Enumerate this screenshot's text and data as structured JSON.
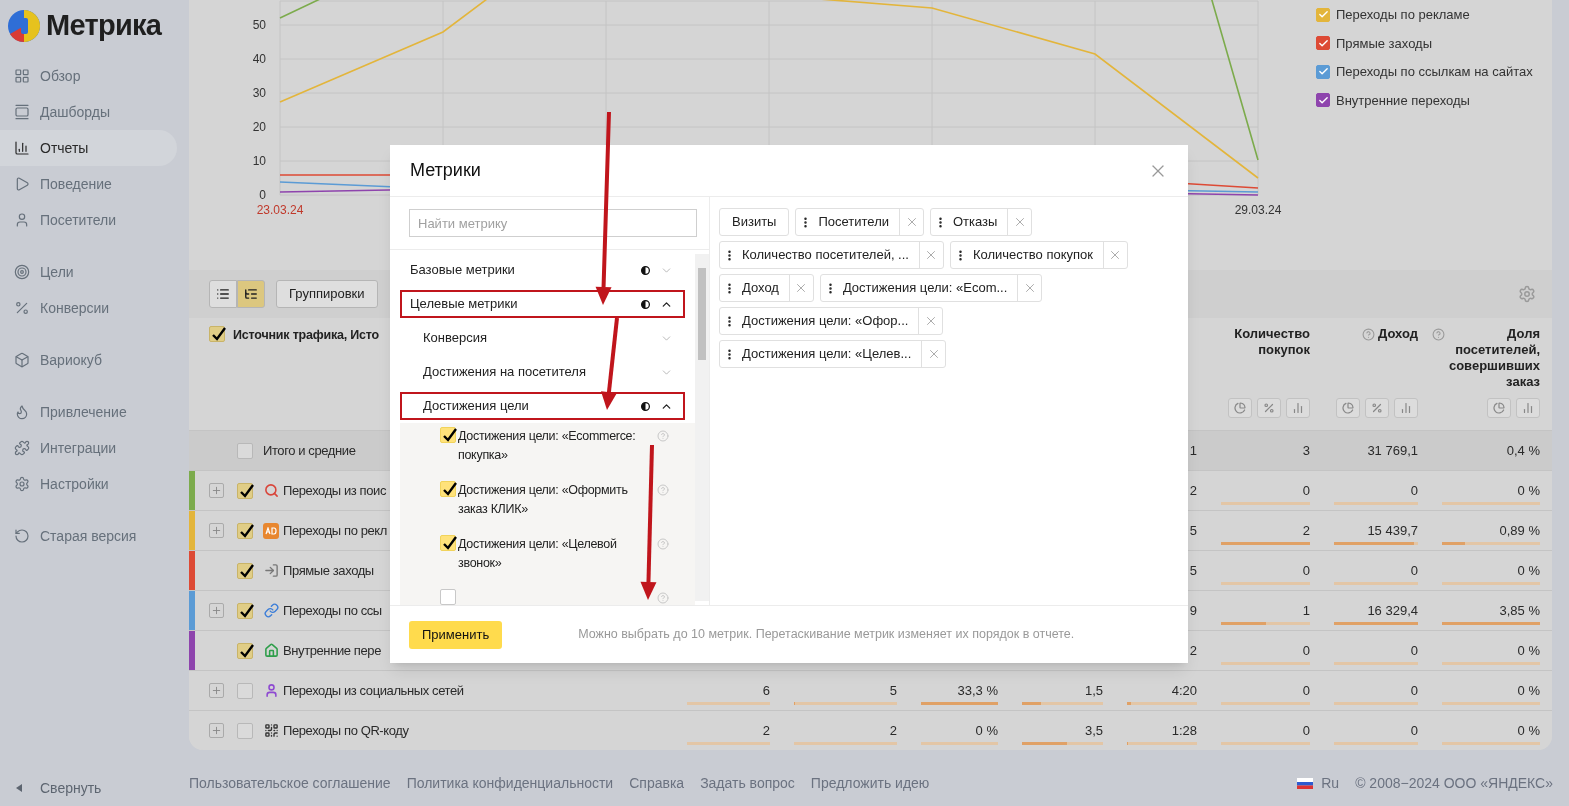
{
  "logo": {
    "text": "Метрика"
  },
  "sidebar": {
    "groups": [
      [
        {
          "label": "Обзор",
          "selected": false
        },
        {
          "label": "Дашборды",
          "selected": false
        },
        {
          "label": "Отчеты",
          "selected": true
        },
        {
          "label": "Поведение",
          "selected": false
        },
        {
          "label": "Посетители",
          "selected": false
        }
      ],
      [
        {
          "label": "Цели",
          "selected": false
        },
        {
          "label": "Конверсии",
          "selected": false
        }
      ],
      [
        {
          "label": "Вариокуб",
          "selected": false
        }
      ],
      [
        {
          "label": "Привлечение",
          "selected": false
        },
        {
          "label": "Интеграции",
          "selected": false
        },
        {
          "label": "Настройки",
          "selected": false
        }
      ],
      [
        {
          "label": "Старая версия",
          "selected": false
        }
      ]
    ],
    "collapse": "Свернуть"
  },
  "chart": {
    "y_labels": [
      "50",
      "40",
      "30",
      "20",
      "10",
      "0"
    ],
    "date_labels": [
      {
        "label": "23.03.24",
        "weekend": true
      },
      {
        "label": "29.03.24",
        "weekend": false
      }
    ],
    "legend": [
      {
        "label": "Переходы по рекламе",
        "checked": true,
        "color": "#e3b53b"
      },
      {
        "label": "Прямые заходы",
        "checked": true,
        "color": "#dd4a35"
      },
      {
        "label": "Переходы по ссылкам на сайтах",
        "checked": true,
        "color": "#5b9bd5"
      },
      {
        "label": "Внутренние переходы",
        "checked": true,
        "color": "#8e44ad"
      }
    ]
  },
  "toolbar": {
    "views": [
      {
        "kind": "list",
        "selected": false
      },
      {
        "kind": "tree",
        "selected": true
      }
    ],
    "grouping": "Группировки"
  },
  "table": {
    "dimension": {
      "label": "Источник трафика, Исто",
      "checked": true
    },
    "columns": [
      {},
      {},
      {},
      {},
      {},
      {
        "label": "Количество покупок",
        "help": false,
        "tools": [
          {
            "kind": "pie"
          },
          {
            "kind": "percent"
          },
          {
            "kind": "bars"
          }
        ]
      },
      {
        "label": "Доход",
        "help": true,
        "tools": [
          {
            "kind": "pie"
          },
          {
            "kind": "percent"
          },
          {
            "kind": "bars"
          }
        ]
      },
      {
        "label": "Доля посетителей, совершивших заказ",
        "help": true,
        "tools": [
          {
            "kind": "pie"
          },
          {
            "kind": "bars"
          }
        ]
      }
    ],
    "rows": [
      {
        "kind": "total",
        "label": "Итого и средние",
        "checked": false,
        "expandable": false,
        "cells": [
          {},
          {},
          {},
          {},
          {
            "value": "1"
          },
          {
            "value": "3"
          },
          {
            "value": "31 769,1"
          },
          {
            "value": "0,4 %"
          }
        ]
      },
      {
        "kind": "source",
        "label": "Переходы из поис",
        "checked": true,
        "expandable": true,
        "color": "#7cab4c",
        "cells": [
          {},
          {},
          {},
          {},
          {
            "value": "2"
          },
          {
            "value": "0",
            "level": 0
          },
          {
            "value": "0",
            "level": 0
          },
          {
            "value": "0 %",
            "level": 0
          }
        ]
      },
      {
        "kind": "source",
        "label": "Переходы по рекл",
        "checked": true,
        "expandable": true,
        "color": "#e3b53b",
        "cells": [
          {},
          {},
          {},
          {},
          {
            "value": "5"
          },
          {
            "value": "2",
            "level": 1
          },
          {
            "value": "15 439,7",
            "level": 0.95
          },
          {
            "value": "0,89 %",
            "level": 0.23
          }
        ]
      },
      {
        "kind": "source",
        "label": "Прямые заходы",
        "checked": true,
        "expandable": false,
        "color": "#dd4a35",
        "cells": [
          {},
          {},
          {},
          {},
          {
            "value": "5"
          },
          {
            "value": "0",
            "level": 0
          },
          {
            "value": "0",
            "level": 0
          },
          {
            "value": "0 %",
            "level": 0
          }
        ]
      },
      {
        "kind": "source",
        "label": "Переходы по ссы",
        "checked": true,
        "expandable": true,
        "color": "#5b9bd5",
        "cells": [
          {},
          {},
          {},
          {},
          {
            "value": "9"
          },
          {
            "value": "1",
            "level": 0.5
          },
          {
            "value": "16 329,4",
            "level": 1
          },
          {
            "value": "3,85 %",
            "level": 1
          }
        ]
      },
      {
        "kind": "source",
        "label": "Внутренние пере",
        "checked": true,
        "expandable": false,
        "color": "#8e44ad",
        "cells": [
          {},
          {},
          {},
          {},
          {
            "value": "2"
          },
          {
            "value": "0",
            "level": 0
          },
          {
            "value": "0",
            "level": 0
          },
          {
            "value": "0 %",
            "level": 0
          }
        ]
      },
      {
        "kind": "source",
        "label": "Переходы из социальных сетей",
        "checked": false,
        "expandable": true,
        "cells": [
          {
            "value": "6",
            "level": 0
          },
          {
            "value": "5",
            "level": 0.01
          },
          {
            "value": "33,3 %",
            "level": 1
          },
          {
            "value": "1,5",
            "level": 0.23
          },
          {
            "value": "4:20",
            "level": 0.06
          },
          {
            "value": "0",
            "level": 0
          },
          {
            "value": "0",
            "level": 0
          },
          {
            "value": "0 %",
            "level": 0
          }
        ]
      },
      {
        "kind": "source",
        "label": "Переходы по QR-коду",
        "checked": false,
        "expandable": true,
        "cells": [
          {
            "value": "2",
            "level": 0
          },
          {
            "value": "2",
            "level": 0
          },
          {
            "value": "0 %",
            "level": 0
          },
          {
            "value": "3,5",
            "level": 0.55
          },
          {
            "value": "1:28",
            "level": 0.01
          },
          {
            "value": "0",
            "level": 0
          },
          {
            "value": "0",
            "level": 0
          },
          {
            "value": "0 %",
            "level": 0
          }
        ]
      }
    ]
  },
  "footer": {
    "links": [
      "Пользовательское соглашение",
      "Политика конфиденциальности",
      "Справка",
      "Задать вопрос",
      "Предложить идею"
    ],
    "language": "Ru",
    "copyright": "© 2008−2024 ООО «ЯНДЕКС»"
  },
  "dialog": {
    "title": "Метрики",
    "search": {
      "placeholder": "Найти метрику"
    },
    "tree": [
      {
        "label": "Базовые метрики",
        "segment_icon": true,
        "expanded": false,
        "highlighted": false
      },
      {
        "label": "Целевые метрики",
        "segment_icon": true,
        "expanded": true,
        "highlighted": true,
        "children": [
          {
            "label": "Конверсия",
            "segment_icon": false,
            "expanded": false,
            "highlighted": false
          },
          {
            "label": "Достижения на посетителя",
            "segment_icon": false,
            "expanded": false,
            "highlighted": false
          },
          {
            "label": "Достижения цели",
            "segment_icon": true,
            "expanded": true,
            "highlighted": true,
            "children": [
              {
                "kind": "metric",
                "label": "Достижения цели: «Ecommerce: покупка»",
                "checked": true
              },
              {
                "kind": "metric",
                "label": "Достижения цели: «Оформить заказ КЛИК»",
                "checked": true
              },
              {
                "kind": "metric",
                "label": "Достижения цели: «Целевой звонок»",
                "checked": true
              },
              {
                "kind": "metric",
                "checked": false
              }
            ]
          }
        ]
      }
    ],
    "chips": [
      {
        "label": "Визиты",
        "removable": false
      },
      {
        "label": "Посетители",
        "removable": true
      },
      {
        "label": "Отказы",
        "removable": true
      },
      {
        "label": "Количество посетителей, ...",
        "removable": true
      },
      {
        "label": "Количество покупок",
        "removable": true
      },
      {
        "label": "Доход",
        "removable": true
      },
      {
        "label": "Достижения цели: «Ecom...",
        "removable": true
      },
      {
        "label": "Достижения цели: «Офор...",
        "removable": true
      },
      {
        "label": "Достижения цели: «Целев...",
        "removable": true
      }
    ],
    "apply": "Применить",
    "hint": "Можно выбрать до 10 метрик. Перетаскивание метрик изменяет их порядок в отчете."
  }
}
